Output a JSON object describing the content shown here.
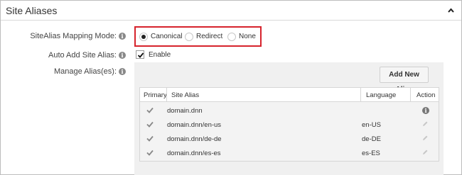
{
  "section": {
    "title": "Site Aliases"
  },
  "mapping_mode": {
    "label": "SiteAlias Mapping Mode:",
    "options": [
      {
        "label": "Canonical",
        "selected": true
      },
      {
        "label": "Redirect",
        "selected": false
      },
      {
        "label": "None",
        "selected": false
      }
    ]
  },
  "auto_add": {
    "label": "Auto Add Site Alias:",
    "checkbox_label": "Enable",
    "checked": true
  },
  "manage": {
    "label": "Manage Alias(es):",
    "add_button": "Add New Alias"
  },
  "info_glyph": "i",
  "table": {
    "headers": {
      "primary": "Primary",
      "alias": "Site Alias",
      "language": "Language",
      "action": "Action"
    },
    "rows": [
      {
        "primary": true,
        "alias": "domain.dnn",
        "language": "",
        "action": "info-icon"
      },
      {
        "primary": true,
        "alias": "domain.dnn/en-us",
        "language": "en-US",
        "action": "pencil-icon"
      },
      {
        "primary": true,
        "alias": "domain.dnn/de-de",
        "language": "de-DE",
        "action": "pencil-icon"
      },
      {
        "primary": true,
        "alias": "domain.dnn/es-es",
        "language": "es-ES",
        "action": "pencil-icon"
      }
    ]
  },
  "colors": {
    "highlight_border": "#d6232c",
    "panel_bg": "#f0f0f0",
    "check_gray": "#888888"
  }
}
